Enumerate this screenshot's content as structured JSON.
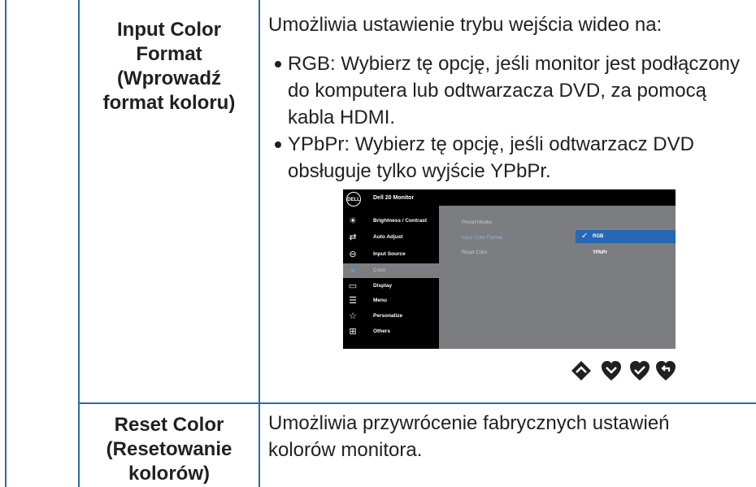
{
  "rows": [
    {
      "label": "Input Color\nFormat\n(Wprowadź\nformat koloru)",
      "description": "Umożliwia ustawienie trybu wejścia wideo na:",
      "bullets": [
        "RGB: Wybierz tę opcję, jeśli monitor jest podłączony\ndo komputera lub odtwarzacza DVD, za pomocą\nkabla HDMI.",
        "YPbPr: Wybierz tę opcję, jeśli odtwarzacz DVD\nobsługuje tylko wyjście YPbPr."
      ]
    },
    {
      "label": "Reset Color\n(Resetowanie\nkolorów)",
      "description": "Umożliwia przywrócenie fabrycznych ustawień\nkolorów monitora."
    }
  ],
  "osd": {
    "logo": "DELL",
    "title": "Dell 20 Monitor",
    "menu": [
      {
        "label": "Brightness / Contrast",
        "icon": "brightness-icon"
      },
      {
        "label": "Auto Adjust",
        "icon": "auto-adjust-icon"
      },
      {
        "label": "Input Source",
        "icon": "input-source-icon"
      },
      {
        "label": "Color",
        "icon": "color-icon",
        "active": true
      },
      {
        "label": "Display",
        "icon": "display-icon"
      },
      {
        "label": "Menu",
        "icon": "menu-icon"
      },
      {
        "label": "Personalize",
        "icon": "star-icon"
      },
      {
        "label": "Others",
        "icon": "others-icon"
      }
    ],
    "submenu": [
      "Preset Modes",
      "Input Color Format",
      "Reset Color"
    ],
    "options": [
      "RGB",
      "YPbPr"
    ],
    "selected_option": "RGB"
  },
  "nav_buttons": [
    "up-icon",
    "down-icon",
    "confirm-icon",
    "back-icon"
  ],
  "colors": {
    "rule": "#2b6aa8",
    "osd_panel": "#7c7d80",
    "osd_selected": "#2767b4"
  }
}
